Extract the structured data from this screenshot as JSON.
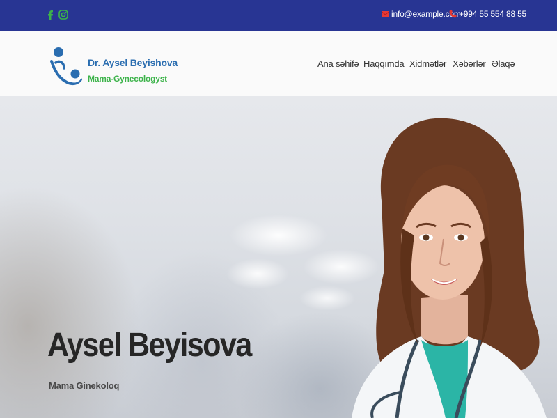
{
  "topbar": {
    "social": [
      {
        "icon": "facebook-icon",
        "label": "f"
      },
      {
        "icon": "instagram-icon"
      }
    ],
    "email": "info@example.com",
    "phone": "+994 55 554 88 55",
    "colors": {
      "background": "#283593",
      "social": "#3cb34a",
      "contact_icon": "#e53935"
    }
  },
  "brand": {
    "name": "Dr. Aysel Beyishova",
    "tagline": "Mama-Gynecologyst",
    "colors": {
      "name": "#2a6db0",
      "tagline": "#3cb34a"
    }
  },
  "nav": {
    "items": [
      {
        "label": "Ana səhifə"
      },
      {
        "label": "Haqqımda"
      },
      {
        "label": "Xidmətlər"
      },
      {
        "label": "Xəbərlər"
      },
      {
        "label": "Əlaqə"
      }
    ]
  },
  "hero": {
    "title": "Aysel Beyisova",
    "subtitle": "Mama Ginekoloq"
  }
}
